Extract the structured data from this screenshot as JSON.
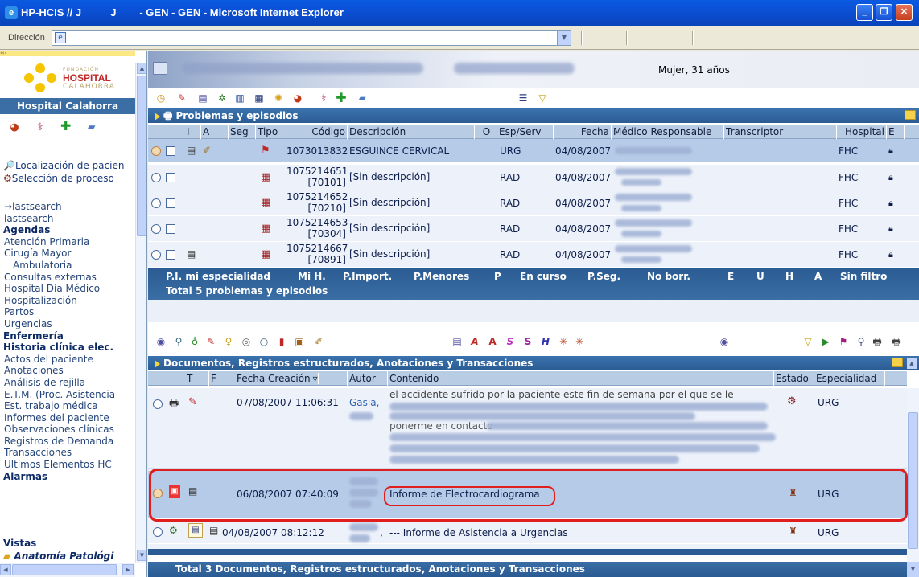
{
  "window": {
    "title": "HP-HCIS // J          J        - GEN - GEN - Microsoft Internet Explorer"
  },
  "address": {
    "label": "Dirección"
  },
  "sidebar": {
    "logo": {
      "line1": "FUNDACIÓN",
      "line2": "HOSPITAL",
      "line3": "CALAHORRA"
    },
    "header": "Hospital Calahorra",
    "links": [
      "Localización de pacien",
      "Selección de proceso"
    ],
    "tree": [
      {
        "t": "→lastsearch",
        "k": "i"
      },
      {
        "t": "lastsearch",
        "k": "i"
      },
      {
        "t": "Agendas",
        "k": "h"
      },
      {
        "t": "Atención Primaria",
        "k": "i"
      },
      {
        "t": "Cirugía Mayor",
        "k": "i"
      },
      {
        "t": "Ambulatoria",
        "k": "ii"
      },
      {
        "t": "Consultas externas",
        "k": "i"
      },
      {
        "t": "Hospital Día Médico",
        "k": "i"
      },
      {
        "t": "Hospitalización",
        "k": "i"
      },
      {
        "t": "Partos",
        "k": "i"
      },
      {
        "t": "Urgencias",
        "k": "i"
      },
      {
        "t": "Enfermería",
        "k": "h"
      },
      {
        "t": "Historia clínica elec.",
        "k": "h"
      },
      {
        "t": "Actos del paciente",
        "k": "i"
      },
      {
        "t": "Anotaciones",
        "k": "i"
      },
      {
        "t": "Análisis de rejilla",
        "k": "i"
      },
      {
        "t": "E.T.M. (Proc. Asistencia",
        "k": "i"
      },
      {
        "t": "Est. trabajo médica",
        "k": "i"
      },
      {
        "t": "Informes del paciente",
        "k": "i"
      },
      {
        "t": "Observaciones clínicas",
        "k": "i"
      },
      {
        "t": "Registros de Demanda",
        "k": "i"
      },
      {
        "t": "Transacciones",
        "k": "i"
      },
      {
        "t": "Ultimos Elementos HC",
        "k": "i"
      },
      {
        "t": "Alarmas",
        "k": "h"
      }
    ],
    "vistas": "Vistas",
    "anat": "Anatomía Patológi"
  },
  "patient": {
    "sex_age": "Mujer, 31 años"
  },
  "problems": {
    "title": "Problemas y episodios",
    "columns": [
      "I",
      "A",
      "Seg",
      "Tipo",
      "Código",
      "Descripción",
      "O",
      "Esp/Serv",
      "Fecha",
      "Médico Responsable",
      "Transcriptor",
      "Hospital",
      "E"
    ],
    "rows": [
      {
        "code": "1073013832",
        "code2": "",
        "desc": "ESGUINCE CERVICAL",
        "esp": "URG",
        "fecha": "04/08/2007",
        "hosp": "FHC"
      },
      {
        "code": "1075214651",
        "code2": "[70101]",
        "desc": "[Sin descripción]",
        "esp": "RAD",
        "fecha": "04/08/2007",
        "hosp": "FHC"
      },
      {
        "code": "1075214652",
        "code2": "[70210]",
        "desc": "[Sin descripción]",
        "esp": "RAD",
        "fecha": "04/08/2007",
        "hosp": "FHC"
      },
      {
        "code": "1075214653",
        "code2": "[70304]",
        "desc": "[Sin descripción]",
        "esp": "RAD",
        "fecha": "04/08/2007",
        "hosp": "FHC"
      },
      {
        "code": "1075214667",
        "code2": "[70891]",
        "desc": "[Sin descripción]",
        "esp": "RAD",
        "fecha": "04/08/2007",
        "hosp": "FHC"
      }
    ],
    "filters": [
      "P.I. mi especialidad",
      "Mi H.",
      "P.Import.",
      "P.Menores",
      "P",
      "En curso",
      "P.Seg.",
      "No borr.",
      "E",
      "U",
      "H",
      "A",
      "Sin filtro"
    ],
    "total": "Total 5 problemas y episodios"
  },
  "documents": {
    "title": "Documentos, Registros estructurados, Anotaciones y Transacciones",
    "columns": [
      "T",
      "F",
      "Fecha Creación",
      "Autor",
      "Contenido",
      "Estado",
      "Especialidad"
    ],
    "rows": [
      {
        "fecha": "07/08/2007 11:06:31",
        "autor": "Gasia,",
        "contenido": "el accidente sufrido por la paciente este fin de semana por el que se le",
        "extra": "ponerme en contacto",
        "esp": "URG"
      },
      {
        "fecha": "06/08/2007 07:40:09",
        "autor": "",
        "contenido": "Informe de Electrocardiograma",
        "extra": "",
        "esp": "URG"
      },
      {
        "fecha": "04/08/2007 08:12:12",
        "autor": "",
        "contenido": "--- Informe de Asistencia a Urgencias",
        "extra": "",
        "esp": "URG"
      }
    ],
    "total": "Total 3 Documentos, Registros estructurados, Anotaciones y Transacciones"
  }
}
